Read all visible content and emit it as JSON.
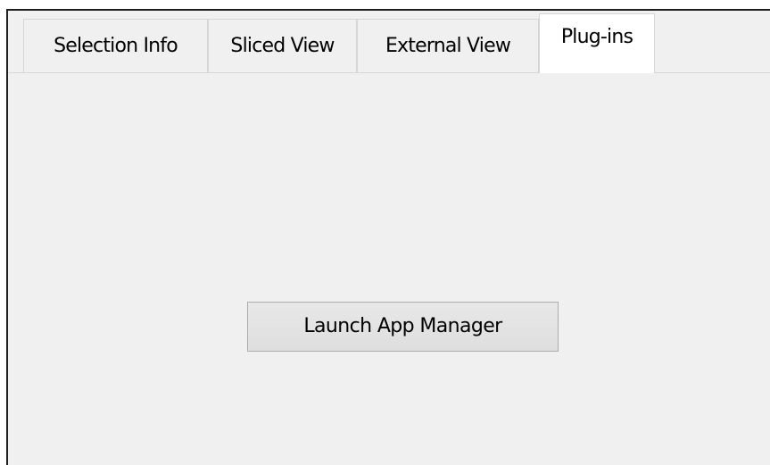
{
  "tabs": [
    {
      "label": "Selection Info",
      "active": false
    },
    {
      "label": "Sliced View",
      "active": false
    },
    {
      "label": "External View",
      "active": false
    },
    {
      "label": "Plug-ins",
      "active": true
    }
  ],
  "main": {
    "launch_button_label": "Launch App Manager"
  },
  "colors": {
    "panel_background": "#f0f0f0",
    "active_tab_background": "#ffffff",
    "border": "#d6d6d6",
    "outer_border": "#1f1f1f"
  }
}
